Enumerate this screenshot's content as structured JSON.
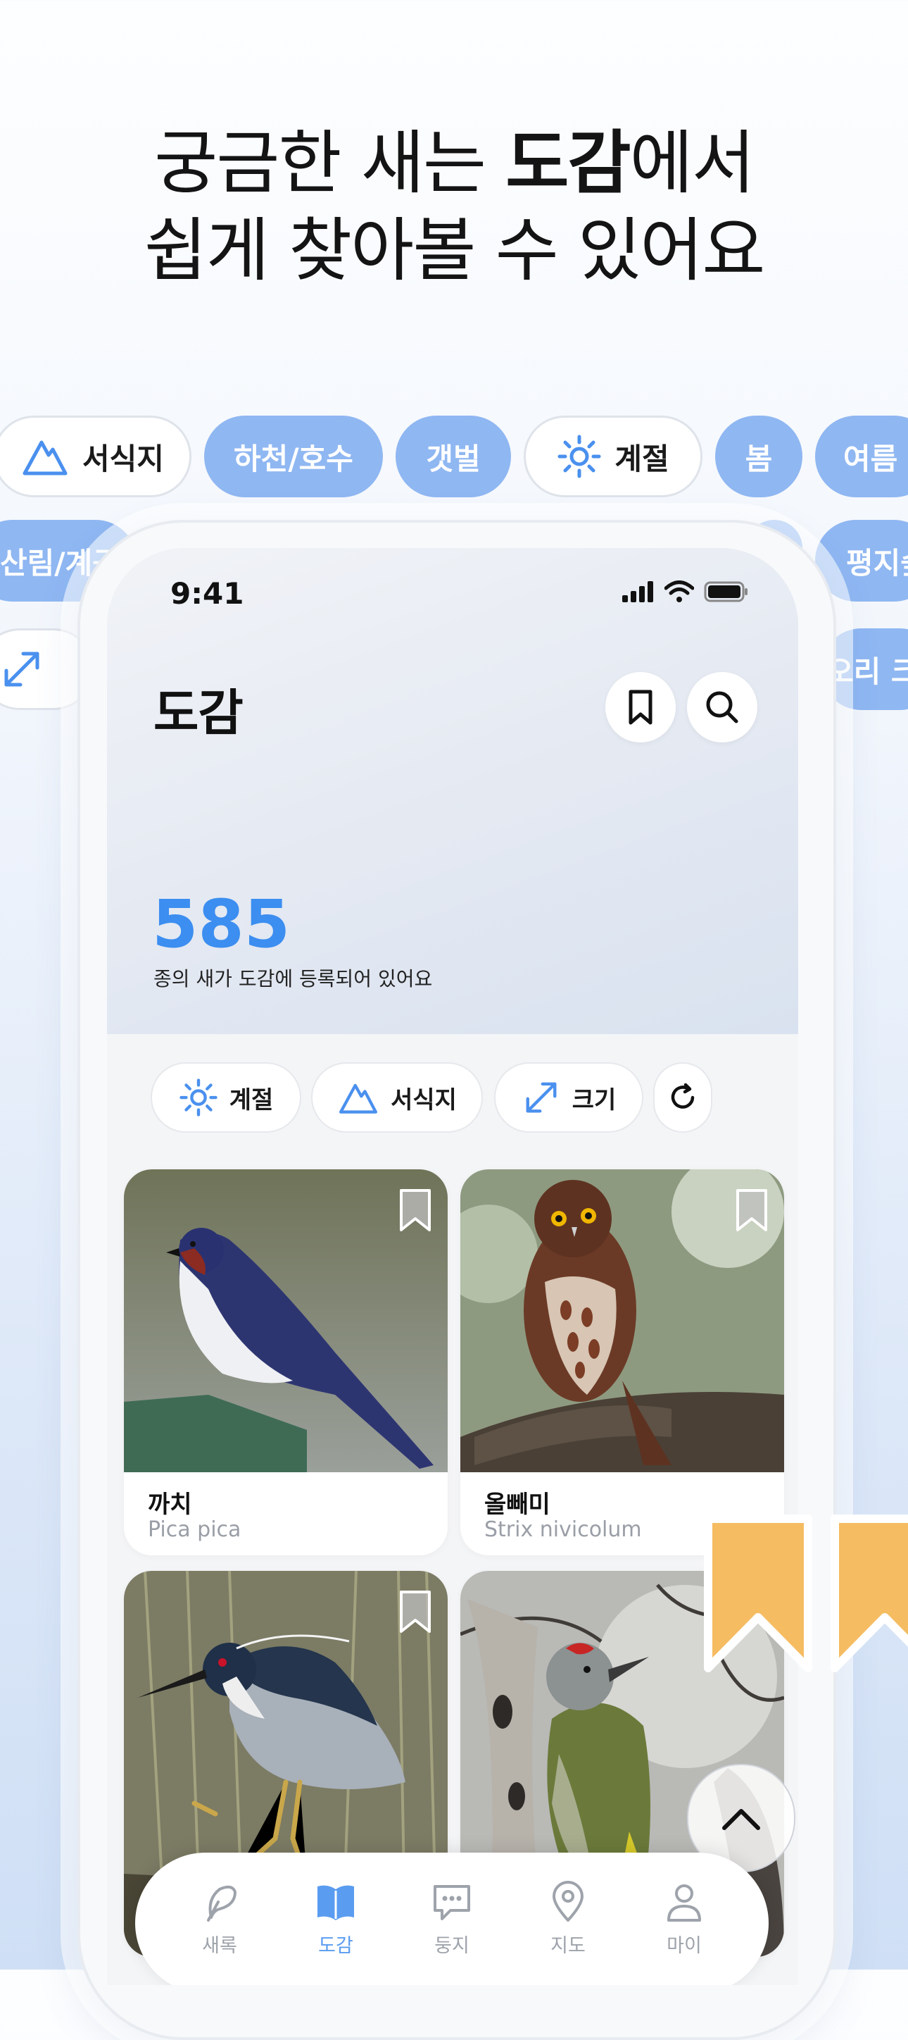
{
  "headline": {
    "line1_pre": "궁금한 새는 ",
    "line1_bold": "도감",
    "line1_post": "에서",
    "line2": "쉽게 찾아볼 수 있어요"
  },
  "bg_chips": {
    "row1": [
      "서식지",
      "하천/호수",
      "갯벌",
      "계절",
      "봄",
      "여름"
    ],
    "row2": [
      "산림/계곡",
      "평지숲"
    ],
    "row3": [
      "크기",
      "오리 크기"
    ]
  },
  "status": {
    "time": "9:41"
  },
  "screen": {
    "title": "도감",
    "count": "585",
    "count_sub": "종의 새가 도감에 등록되어 있어요",
    "filters": [
      "계절",
      "서식지",
      "크기"
    ]
  },
  "cards": [
    {
      "name": "까치",
      "sci": "Pica pica"
    },
    {
      "name": "올빼미",
      "sci": "Strix nivicolum"
    }
  ],
  "tabs": [
    "새록",
    "도감",
    "둥지",
    "지도",
    "마이"
  ],
  "colors": {
    "accent": "#3c8ef0",
    "chip_blue": "#8fb7f2",
    "bookmark_orange": "#f5bc62"
  }
}
